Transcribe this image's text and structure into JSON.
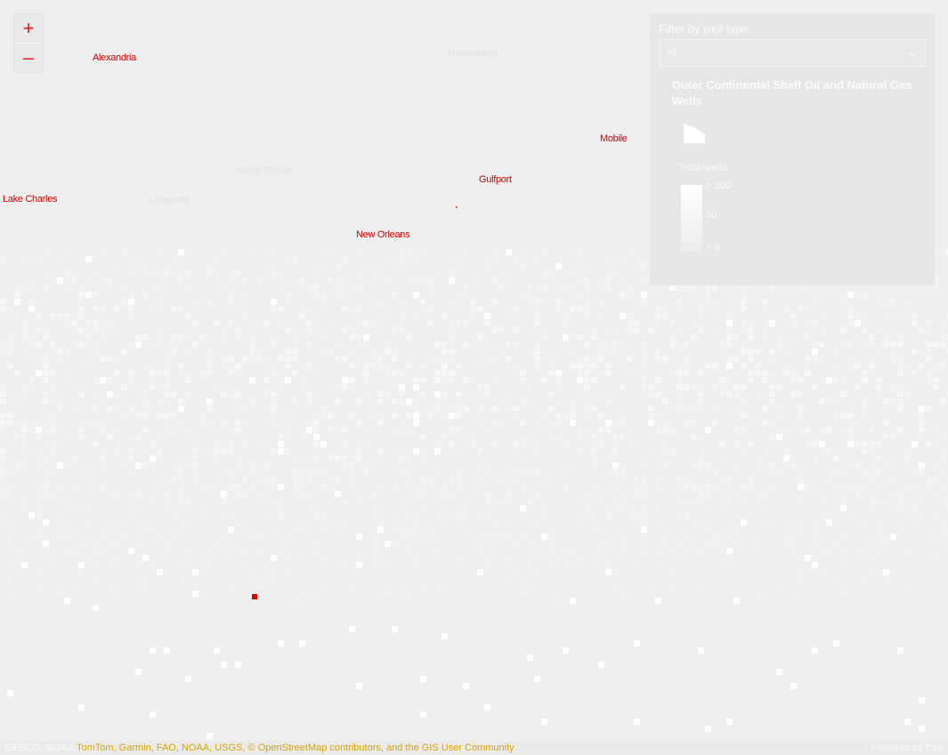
{
  "map": {
    "cities": [
      {
        "label": "Alexandria"
      },
      {
        "label": "Mobile"
      },
      {
        "label": "Gulfport"
      },
      {
        "label": "Lake Charles"
      },
      {
        "label": "New Orleans"
      }
    ],
    "faint_places": [
      {
        "label": "Hattiesburg"
      },
      {
        "label": "Baton Rouge"
      },
      {
        "label": "Lafayette"
      }
    ],
    "accent_color": "#e00000"
  },
  "zoom": {
    "in_icon": "+",
    "out_icon": "–"
  },
  "filter": {
    "label": "Filter by well type:",
    "value": "all"
  },
  "legend": {
    "title": "Outer Continental Shelf Oil and Natural Gas Wells",
    "total_label": "Total wells",
    "ramp_labels": [
      "> 200",
      "50",
      "< 0"
    ]
  },
  "attribution": {
    "left": "GEBCO, NOAA, Esri",
    "sources": "TomTom, Garmin, FAO, NOAA, USGS, © OpenStreetMap contributors, and the GIS User Community",
    "right": "Powered by Esri"
  }
}
